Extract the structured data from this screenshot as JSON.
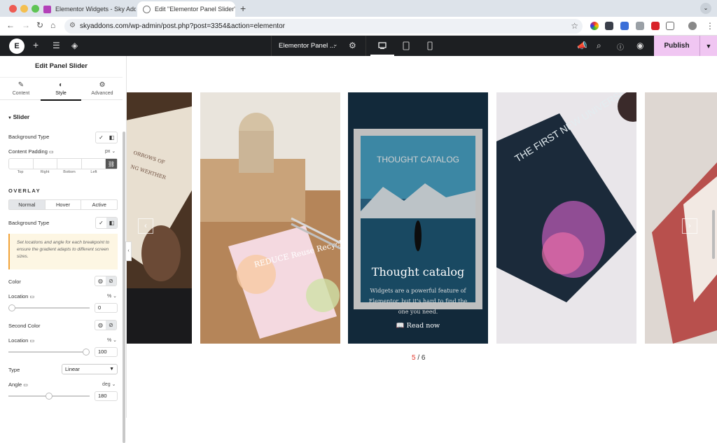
{
  "browser": {
    "tabs": [
      {
        "title": "Elementor Widgets - Sky Add"
      },
      {
        "title": "Edit \"Elementor Panel Slider\""
      }
    ],
    "url": "skyaddons.com/wp-admin/post.php?post=3354&action=elementor",
    "colors": {
      "active_tab": "#ffffff",
      "tab_bar": "#dde3ea"
    }
  },
  "editor_bar": {
    "document_title": "Elementor Panel ...",
    "publish_label": "Publish",
    "colors": {
      "bar": "#1d1f22",
      "publish": "#f0c6f2"
    }
  },
  "panel": {
    "title": "Edit Panel Slider",
    "tabs": [
      {
        "label": "Content",
        "icon": "pencil-icon"
      },
      {
        "label": "Style",
        "icon": "contrast-icon"
      },
      {
        "label": "Advanced",
        "icon": "gear-icon"
      }
    ],
    "section": "Slider",
    "background_type_label": "Background Type",
    "content_padding_label": "Content Padding",
    "padding_unit": "px",
    "dims": [
      "Top",
      "Right",
      "Bottom",
      "Left"
    ],
    "overlay_heading": "OVERLAY",
    "states": [
      "Normal",
      "Hover",
      "Active"
    ],
    "overlay_bg_label": "Background Type",
    "note": "Set locations and angle for each breakpoint to ensure the gradient adapts to different screen sizes.",
    "color_label": "Color",
    "location_label": "Location",
    "location_unit": "%",
    "location_value": "0",
    "second_color_label": "Second Color",
    "location2_label": "Location",
    "location2_unit": "%",
    "location2_value": "100",
    "type_label": "Type",
    "type_value": "Linear",
    "angle_label": "Angle",
    "angle_unit": "deg",
    "angle_value": "180",
    "slider_levels": {
      "location": 0,
      "location2": 1,
      "angle": 0.5
    }
  },
  "slider": {
    "caption_title": "Thought catalog",
    "caption_text": "Widgets are a powerful feature of Elementor, but it's hard to find the one you need.",
    "read_more": "Read now",
    "magazine_title": "THOUGHT CATALOG",
    "book_title": "THE FIRST NEW UNIVERSE",
    "recycle_text": "REDUCE Reuse Recycle",
    "current": "5",
    "separator": "/",
    "total": "6"
  }
}
